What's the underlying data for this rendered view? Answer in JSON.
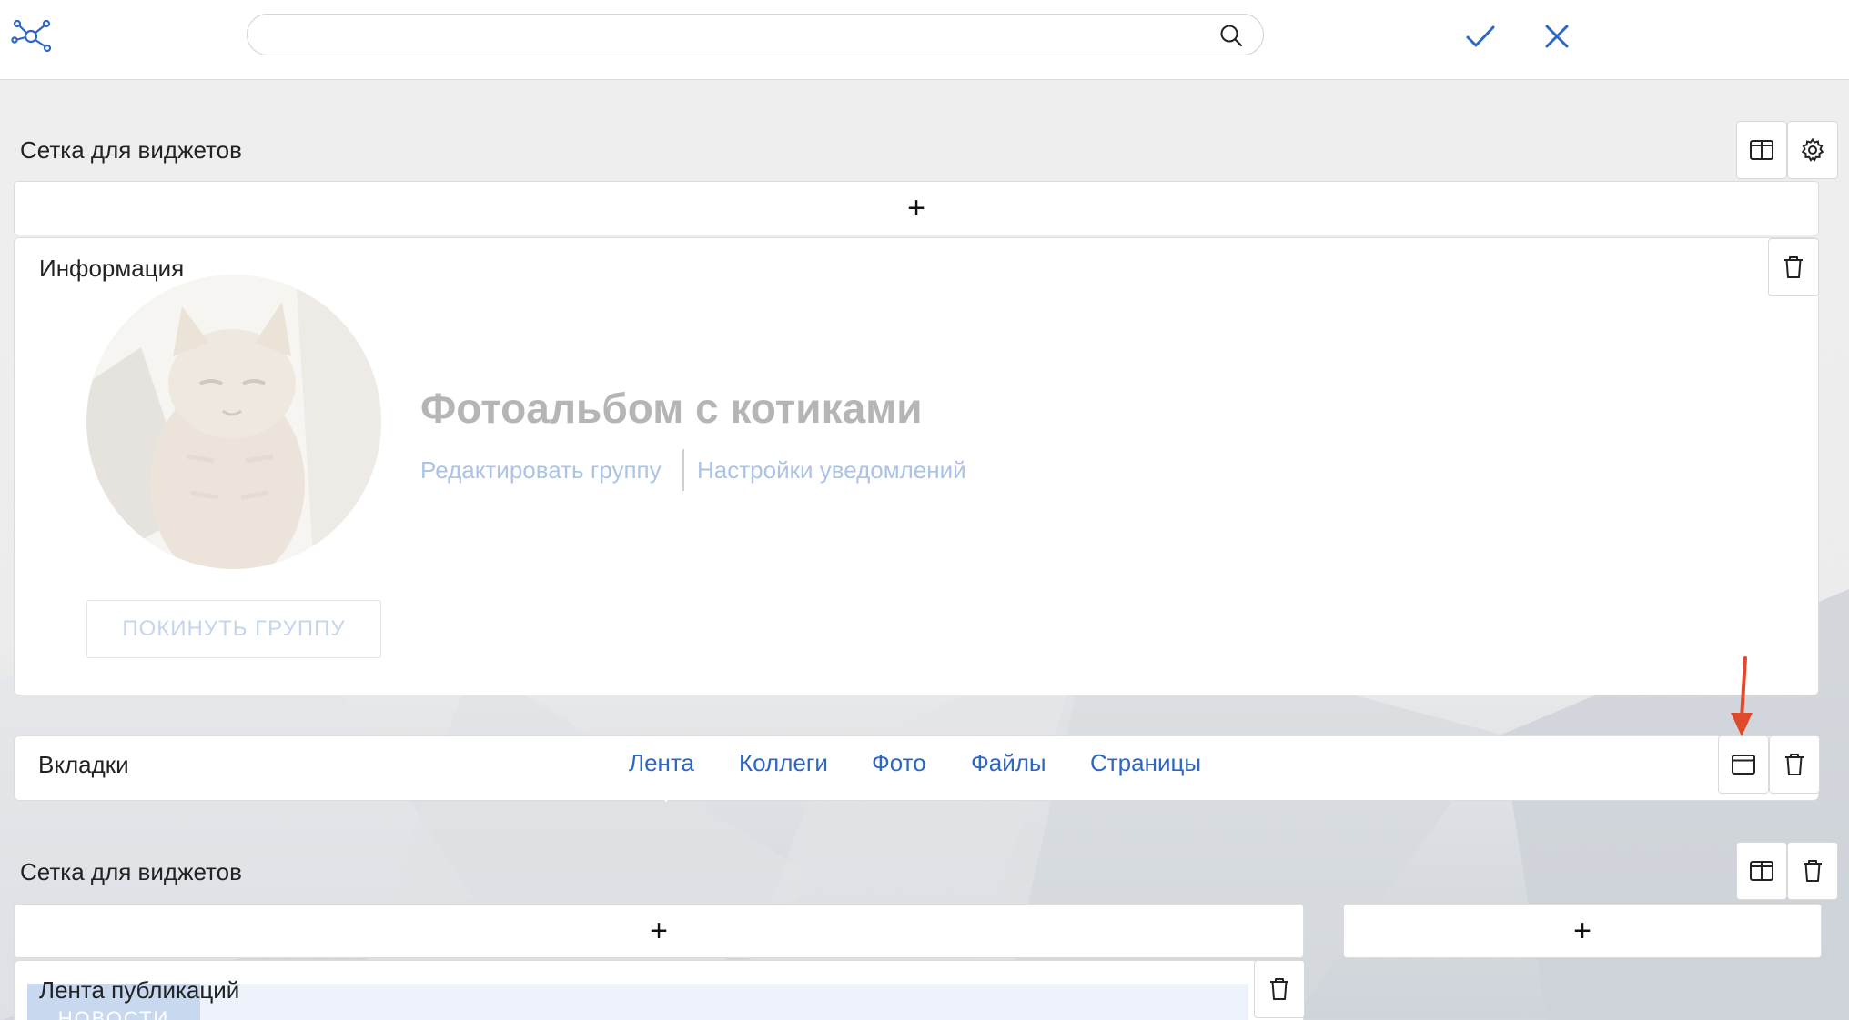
{
  "topbar": {
    "logo_icon": "network-logo-icon",
    "search": {
      "value": "",
      "placeholder": ""
    },
    "confirm_icon": "check-icon",
    "cancel_icon": "close-icon"
  },
  "colors": {
    "accent": "#2d66c3",
    "link_faded": "#aac3e6",
    "annotation_arrow": "#e04a2c"
  },
  "grid1": {
    "title": "Сетка для виджетов",
    "buttons": [
      "columns-icon",
      "gear-icon"
    ],
    "add_label": "+"
  },
  "info_widget": {
    "title": "Информация",
    "group_name": "Фотоальбом с котиками",
    "links": [
      "Редактировать группу",
      "Настройки уведомлений"
    ],
    "leave_button": "ПОКИНУТЬ ГРУППУ",
    "delete_icon": "trash-icon"
  },
  "tabs_widget": {
    "title": "Вкладки",
    "tabs": [
      "Лента",
      "Коллеги",
      "Фото",
      "Файлы",
      "Страницы"
    ],
    "active_tab": "Лента",
    "buttons": [
      "window-icon",
      "trash-icon"
    ]
  },
  "grid2": {
    "title": "Сетка для виджетов",
    "buttons": [
      "columns-icon",
      "trash-icon"
    ],
    "add_label_left": "+",
    "add_label_right": "+"
  },
  "feed_widget": {
    "title": "Лента публикаций",
    "tab_label": "НОВОСТИ",
    "delete_icon": "trash-icon"
  }
}
